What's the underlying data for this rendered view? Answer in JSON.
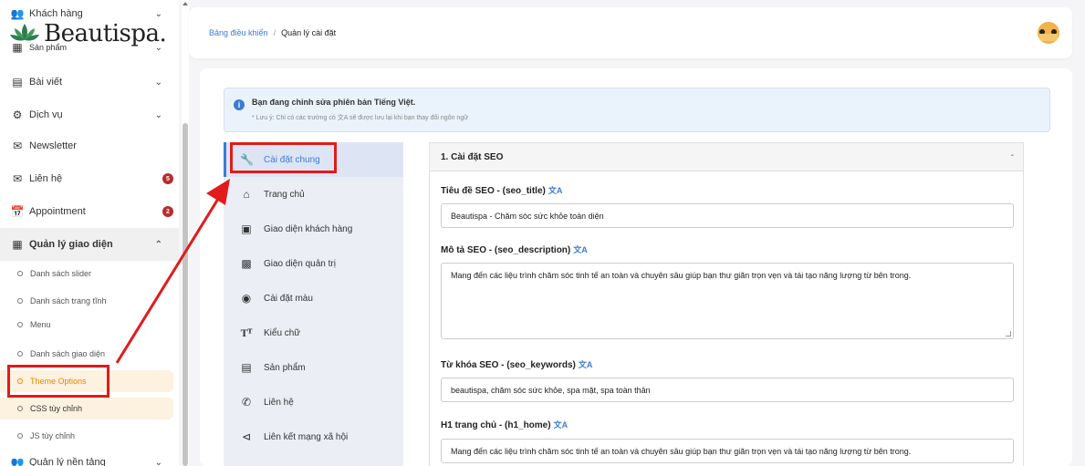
{
  "sidebar": {
    "logo_text": "Beautispa.",
    "items": [
      {
        "label": "Khách hàng",
        "icon": "users-icon"
      },
      {
        "label": "Sản phẩm",
        "icon": "products-icon"
      },
      {
        "label": "Bài viết",
        "icon": "article-icon"
      },
      {
        "label": "Dịch vụ",
        "icon": "services-icon"
      },
      {
        "label": "Newsletter",
        "icon": "mail-icon"
      },
      {
        "label": "Liên hệ",
        "icon": "mail-icon",
        "badge": "5"
      },
      {
        "label": "Appointment",
        "icon": "calendar-icon",
        "badge": "2"
      },
      {
        "label": "Quản lý giao diện",
        "icon": "grid-icon"
      },
      {
        "label": "Quản lý nền tảng",
        "icon": "platform-icon"
      }
    ],
    "sub_items": [
      "Danh sách slider",
      "Danh sách trang tĩnh",
      "Menu",
      "Danh sách giao diện",
      "Theme Options",
      "CSS tùy chỉnh",
      "JS tùy chỉnh"
    ]
  },
  "header": {
    "breadcrumb_link": "Bảng điều khiển",
    "breadcrumb_sep": "/",
    "breadcrumb_current": "Quản lý cài đặt"
  },
  "notice": {
    "title": "Bạn đang chỉnh sửa phiên bản Tiếng Việt.",
    "note": "* Lưu ý: Chỉ có các trường có 文A sẽ được lưu lại khi bạn thay đổi ngôn ngữ"
  },
  "tabs": [
    {
      "label": "Cài đặt chung",
      "icon": "wrench-icon"
    },
    {
      "label": "Trang chủ",
      "icon": "home-icon"
    },
    {
      "label": "Giao diện khách hàng",
      "icon": "image-icon"
    },
    {
      "label": "Giao diện quản trị",
      "icon": "dashboard-icon"
    },
    {
      "label": "Cài đặt màu",
      "icon": "palette-icon"
    },
    {
      "label": "Kiểu chữ",
      "icon": "font-icon"
    },
    {
      "label": "Sản phẩm",
      "icon": "box-icon"
    },
    {
      "label": "Liên hệ",
      "icon": "phone-icon"
    },
    {
      "label": "Liên kết mạng xã hội",
      "icon": "share-icon"
    }
  ],
  "panel": {
    "title": "1. Cài đặt SEO",
    "toggle": "-",
    "translate_icon": "文A",
    "fields": [
      {
        "label": "Tiêu đề SEO - (seo_title)",
        "value": "Beautispa - Chăm sóc sức khỏe toàn diện"
      },
      {
        "label": "Mô tả SEO - (seo_description)",
        "value": "Mang đến các liệu trình chăm sóc tinh tế an toàn và chuyên sâu giúp bạn thư giãn trọn vẹn và tái tạo năng lượng từ bên trong."
      },
      {
        "label": "Từ khóa SEO - (seo_keywords)",
        "value": "beautispa, chăm sóc sức khỏe, spa mặt, spa toàn thân"
      },
      {
        "label": "H1 trang chủ - (h1_home)",
        "value": "Mang đến các liệu trình chăm sóc tinh tế an toàn và chuyên sâu giúp bạn thư giãn trọn vẹn và tái tạo năng lượng từ bên trong."
      }
    ]
  },
  "colors": {
    "accent": "#3b7bd8",
    "annotation": "#e21b1b",
    "active_sub": "#e68a00"
  }
}
